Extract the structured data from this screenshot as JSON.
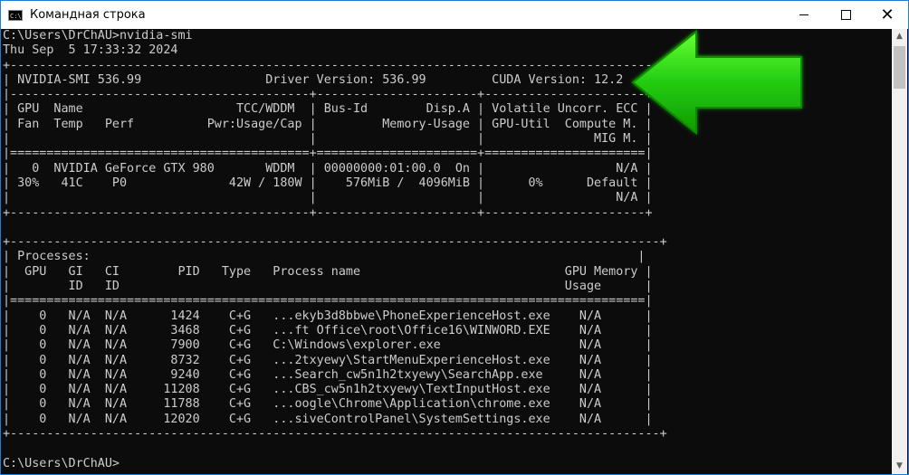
{
  "window": {
    "title": "Командная строка",
    "icon": "console-icon",
    "icon_text": "C:\\",
    "controls": {
      "minimize": "minimize-icon",
      "maximize": "maximize-icon",
      "close": "close-icon"
    }
  },
  "console": {
    "lines": [
      "C:\\Users\\DrChAU>nvidia-smi",
      "Thu Sep  5 17:33:32 2024",
      "+-----------------------------------------------------------------------------------------+",
      "| NVIDIA-SMI 536.99                 Driver Version: 536.99         CUDA Version: 12.2     |",
      "|-----------------------------------------+----------------------+----------------------+",
      "| GPU  Name                     TCC/WDDM  | Bus-Id        Disp.A | Volatile Uncorr. ECC |",
      "| Fan  Temp   Perf          Pwr:Usage/Cap |         Memory-Usage | GPU-Util  Compute M. |",
      "|                                         |                      |               MIG M. |",
      "|=========================================+======================+======================|",
      "|   0  NVIDIA GeForce GTX 980       WDDM  | 00000000:01:00.0  On |                  N/A |",
      "| 30%   41C    P0              42W / 180W |    576MiB /  4096MiB |      0%      Default |",
      "|                                         |                      |                  N/A |",
      "+-----------------------------------------+----------------------+----------------------+",
      "",
      "+-----------------------------------------------------------------------------------------+",
      "| Processes:                                                                           |",
      "|  GPU   GI   CI        PID   Type   Process name                            GPU Memory |",
      "|        ID   ID                                                             Usage      |",
      "|=======================================================================================|",
      "|    0   N/A  N/A      1424    C+G   ...ekyb3d8bbwe\\PhoneExperienceHost.exe    N/A      |",
      "|    0   N/A  N/A      3468    C+G   ...ft Office\\root\\Office16\\WINWORD.EXE    N/A      |",
      "|    0   N/A  N/A      7900    C+G   C:\\Windows\\explorer.exe                   N/A      |",
      "|    0   N/A  N/A      8732    C+G   ...2txyewy\\StartMenuExperienceHost.exe    N/A      |",
      "|    0   N/A  N/A      9240    C+G   ...Search_cw5n1h2txyewy\\SearchApp.exe     N/A      |",
      "|    0   N/A  N/A     11208    C+G   ...CBS_cw5n1h2txyewy\\TextInputHost.exe    N/A      |",
      "|    0   N/A  N/A     11788    C+G   ...oogle\\Chrome\\Application\\chrome.exe    N/A      |",
      "|    0   N/A  N/A     12020    C+G   ...siveControlPanel\\SystemSettings.exe    N/A      |",
      "+-----------------------------------------------------------------------------------------+",
      "",
      "C:\\Users\\DrChAU>"
    ]
  },
  "annotation": {
    "arrow_color": "#22cc22",
    "arrow_icon": "green-arrow-icon"
  },
  "scrollbar": {
    "up": "chevron-up-icon",
    "down": "chevron-down-icon"
  }
}
